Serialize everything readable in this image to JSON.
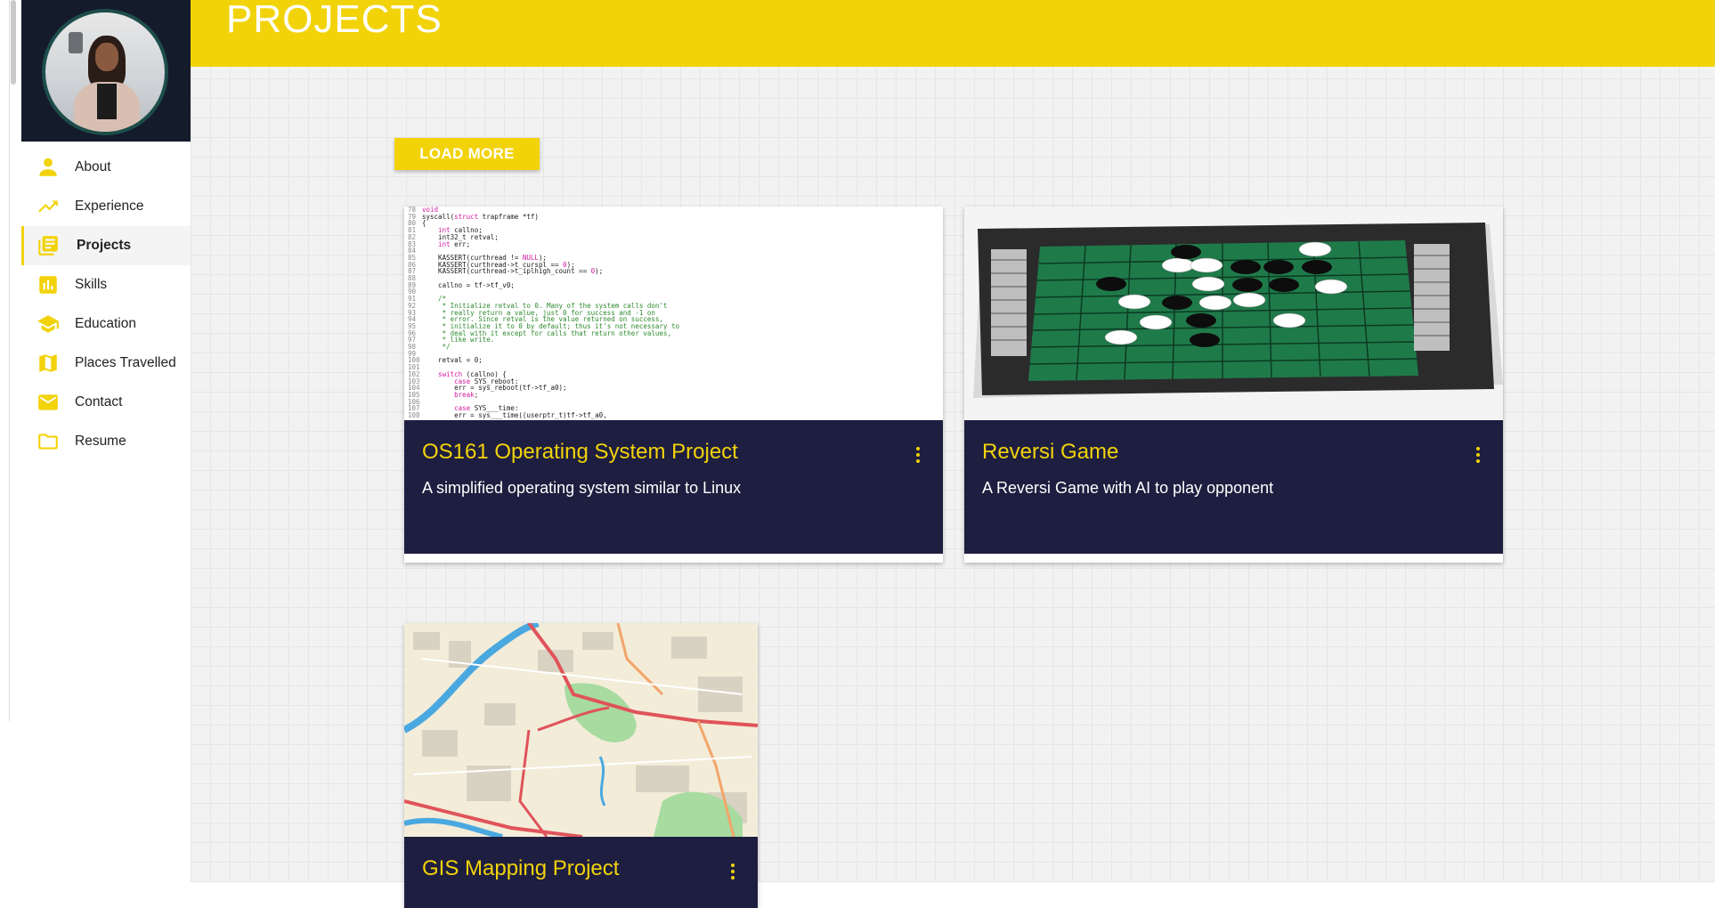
{
  "sidebar": {
    "items": [
      {
        "label": "About",
        "icon": "person-icon"
      },
      {
        "label": "Experience",
        "icon": "trending-up-icon"
      },
      {
        "label": "Projects",
        "icon": "library-books-icon",
        "active": true
      },
      {
        "label": "Skills",
        "icon": "bar-chart-icon"
      },
      {
        "label": "Education",
        "icon": "school-icon"
      },
      {
        "label": "Places Travelled",
        "icon": "map-icon"
      },
      {
        "label": "Contact",
        "icon": "mail-icon"
      },
      {
        "label": "Resume",
        "icon": "folder-icon"
      }
    ]
  },
  "header": {
    "title": "PROJECTS"
  },
  "actions": {
    "load_more": "LOAD MORE"
  },
  "projects": [
    {
      "title": "OS161 Operating System Project",
      "description": "A simplified operating system similar to Linux",
      "image": "code-screenshot"
    },
    {
      "title": "Reversi Game",
      "description": "A Reversi Game with AI to play opponent",
      "image": "reversi-board"
    },
    {
      "title": "GIS Mapping Project",
      "description": "",
      "image": "city-map"
    }
  ],
  "colors": {
    "accent": "#f2d30a",
    "card_body": "#1e1e40",
    "sidebar_header": "#141b2b"
  }
}
